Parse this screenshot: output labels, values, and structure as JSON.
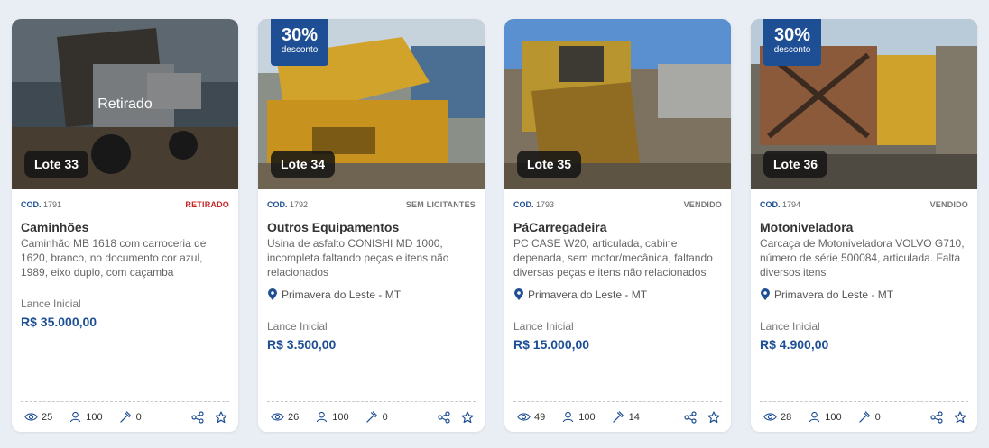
{
  "cards": [
    {
      "lote": "Lote 33",
      "discount": null,
      "overlay": "Retirado",
      "cod_label": "COD.",
      "cod_value": "1791",
      "status": "RETIRADO",
      "title": "Caminhões",
      "description": "Caminhão MB 1618 com carroceria de 1620, branco, no documento cor azul, 1989, eixo duplo, com caçamba",
      "location": "",
      "lance_label": "Lance Inicial",
      "price": "R$ 35.000,00",
      "views": "25",
      "users": "100",
      "bids": "0",
      "status_color": "#c62828"
    },
    {
      "lote": "Lote 34",
      "discount": {
        "pct": "30%",
        "label": "desconto"
      },
      "overlay": "",
      "cod_label": "COD.",
      "cod_value": "1792",
      "status": "SEM LICITANTES",
      "title": "Outros Equipamentos",
      "description": "Usina de asfalto CONISHI MD 1000, incompleta faltando peças e itens não relacionados",
      "location": "Primavera do Leste - MT",
      "lance_label": "Lance Inicial",
      "price": "R$ 3.500,00",
      "views": "26",
      "users": "100",
      "bids": "0",
      "status_color": "#777777"
    },
    {
      "lote": "Lote 35",
      "discount": null,
      "overlay": "",
      "cod_label": "COD.",
      "cod_value": "1793",
      "status": "VENDIDO",
      "title": "PáCarregadeira",
      "description": "PC CASE W20, articulada, cabine depenada, sem motor/mecânica, faltando diversas peças e itens não relacionados",
      "location": "Primavera do Leste - MT",
      "lance_label": "Lance Inicial",
      "price": "R$ 15.000,00",
      "views": "49",
      "users": "100",
      "bids": "14",
      "status_color": "#777777"
    },
    {
      "lote": "Lote 36",
      "discount": {
        "pct": "30%",
        "label": "desconto"
      },
      "overlay": "",
      "cod_label": "COD.",
      "cod_value": "1794",
      "status": "VENDIDO",
      "title": "Motoniveladora",
      "description": "Carcaça de Motoniveladora VOLVO G710, número de série 500084, articulada. Falta diversos itens",
      "location": "Primavera do Leste - MT",
      "lance_label": "Lance Inicial",
      "price": "R$ 4.900,00",
      "views": "28",
      "users": "100",
      "bids": "0",
      "status_color": "#777777"
    }
  ],
  "icons": {
    "views": "eye-icon",
    "users": "user-icon",
    "bids": "gavel-icon",
    "share": "share-icon",
    "favorite": "star-icon",
    "location": "map-pin-icon"
  },
  "colors": {
    "accent": "#1e4f94",
    "withdrawn": "#c62828"
  }
}
